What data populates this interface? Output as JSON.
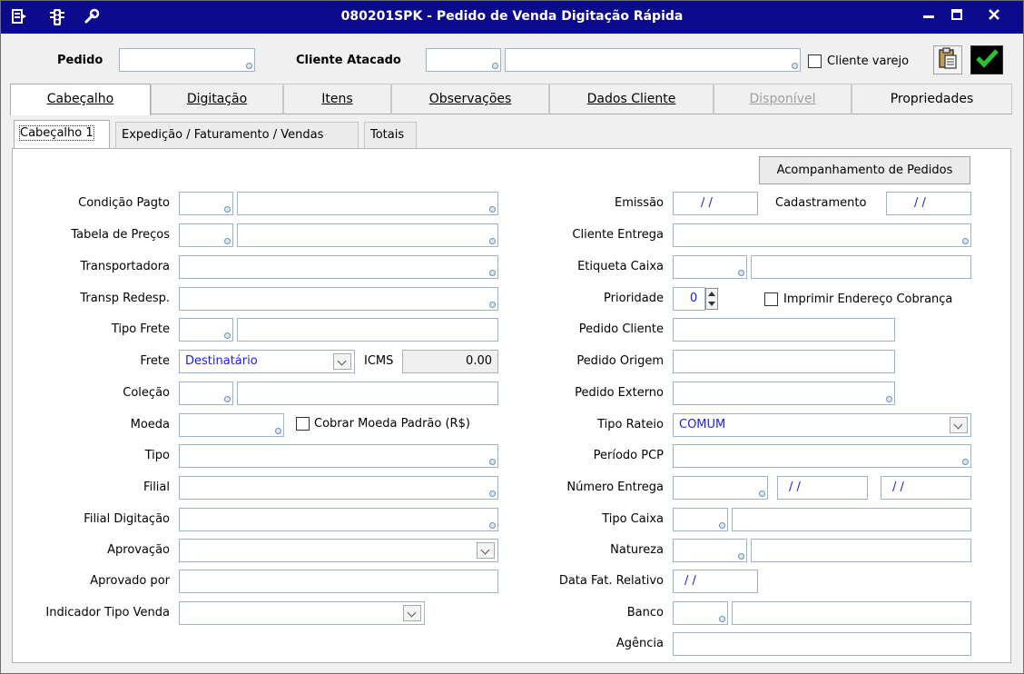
{
  "window": {
    "title": "080201SPK - Pedido de Venda Digitação Rápida",
    "controls": {
      "minimize": "minimize",
      "maximize": "maximize",
      "close": "close"
    }
  },
  "header": {
    "pedido_label": "Pedido",
    "pedido_value": "",
    "cliente_atacado_label": "Cliente Atacado",
    "cliente_code": "",
    "cliente_name": "",
    "cliente_varejo_label": "Cliente varejo",
    "cliente_varejo_checked": false
  },
  "tabs": [
    {
      "label": "Cabeçalho",
      "active": true
    },
    {
      "label": "Digitação"
    },
    {
      "label": "Itens"
    },
    {
      "label": "Observações"
    },
    {
      "label": "Dados Cliente"
    },
    {
      "label": "Disponível",
      "disabled": true
    },
    {
      "label": "Propriedades"
    }
  ],
  "subtabs": [
    {
      "label": "Cabeçalho 1",
      "active": true
    },
    {
      "label": "Expedição / Faturamento / Vendas"
    },
    {
      "label": "Totais"
    }
  ],
  "actions": {
    "acompanhamento": "Acompanhamento de Pedidos"
  },
  "left": {
    "condicao_pagto": "Condição Pagto",
    "tabela_precos": "Tabela de Preços",
    "transportadora": "Transportadora",
    "transp_redesp": "Transp Redesp.",
    "tipo_frete": "Tipo Frete",
    "frete": "Frete",
    "frete_value": "Destinatário",
    "icms": "ICMS",
    "icms_value": "0.00",
    "colecao": "Coleção",
    "moeda": "Moeda",
    "cobrar_moeda": "Cobrar Moeda Padrão (R$)",
    "tipo": "Tipo",
    "filial": "Filial",
    "filial_digitacao": "Filial Digitação",
    "aprovacao": "Aprovação",
    "aprovado_por": "Aprovado por",
    "indicador_tipo_venda": "Indicador Tipo Venda"
  },
  "right": {
    "emissao": "Emissão",
    "emissao_value": "/ /",
    "cadastramento": "Cadastramento",
    "cadastramento_value": "/ /",
    "cliente_entrega": "Cliente Entrega",
    "etiqueta_caixa": "Etiqueta Caixa",
    "prioridade": "Prioridade",
    "prioridade_value": "0",
    "imprimir_endereco": "Imprimir Endereço Cobrança",
    "pedido_cliente": "Pedido Cliente",
    "pedido_origem": "Pedido Origem",
    "pedido_externo": "Pedido Externo",
    "tipo_rateio": "Tipo Rateio",
    "tipo_rateio_value": "COMUM",
    "periodo_pcp": "Período PCP",
    "numero_entrega": "Número Entrega",
    "numero_entrega_date1": "/ /",
    "numero_entrega_date2": "/ /",
    "tipo_caixa": "Tipo Caixa",
    "natureza": "Natureza",
    "data_fat_relativo": "Data Fat. Relativo",
    "data_fat_value": "/ /",
    "banco": "Banco",
    "agencia": "Agência"
  },
  "colors": {
    "titlebar": "#0b0a8c",
    "date_text": "#1a1aff",
    "field_border": "#9cb1cb"
  }
}
